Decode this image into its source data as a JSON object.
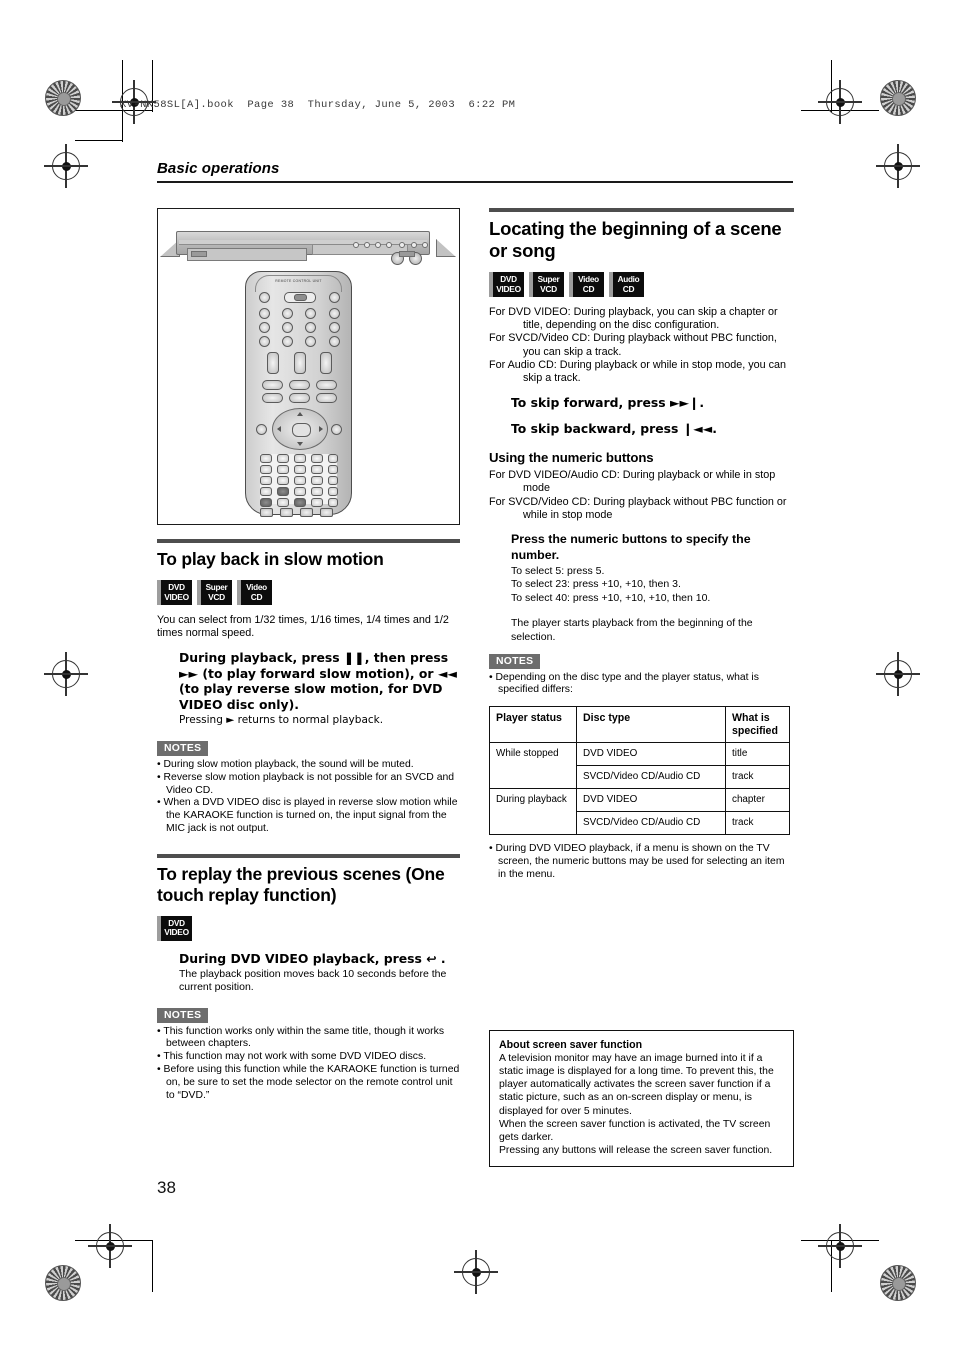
{
  "running_head": "XV-NK58SL[A].book  Page 38  Thursday, June 5, 2003  6:22 PM",
  "section_label": "Basic operations",
  "page_number": "38",
  "figure": {
    "caption": "",
    "remote_brand": "REMOTE CONTROL UNIT"
  },
  "left_column": {
    "section1": {
      "heading": "To play back in slow motion",
      "badges": [
        {
          "line1": "DVD",
          "line2": "VIDEO"
        },
        {
          "line1": "Super",
          "line2": "VCD"
        },
        {
          "line1": "Video",
          "line2": "CD"
        }
      ],
      "intro": "You can select from 1/32 times, 1/16 times, 1/4 times and 1/2 times normal speed.",
      "instruction": "During playback, press ❚❚, then press ►► (to play forward slow motion), or ◄◄ (to play reverse slow motion, for DVD VIDEO disc only).",
      "instruction_note": "Pressing ► returns to normal playback.",
      "notes_label": "NOTES",
      "notes": [
        "During slow motion playback, the sound will be muted.",
        "Reverse slow motion playback is not possible for an SVCD and Video CD.",
        "When a DVD VIDEO disc is played in reverse slow motion while the KARAOKE function is turned on, the input signal from the MIC jack is not output."
      ]
    },
    "section2": {
      "heading": "To replay the previous scenes (One touch replay function)",
      "badges": [
        {
          "line1": "DVD",
          "line2": "VIDEO"
        }
      ],
      "instruction": "During DVD VIDEO playback, press ↩ .",
      "instruction_note": "The playback position moves back 10 seconds before the current position.",
      "notes_label": "NOTES",
      "notes": [
        "This function works only within the same title, though it works between chapters.",
        "This function may not work with some DVD VIDEO discs.",
        "Before using this function while the KARAOKE function is turned on, be sure to set the mode selector on the remote control unit to “DVD.”"
      ]
    }
  },
  "right_column": {
    "heading": "Locating the beginning of a scene or song",
    "badges": [
      {
        "line1": "DVD",
        "line2": "VIDEO"
      },
      {
        "line1": "Super",
        "line2": "VCD"
      },
      {
        "line1": "Video",
        "line2": "CD"
      },
      {
        "line1": "Audio",
        "line2": "CD"
      }
    ],
    "intro_lines": [
      "For DVD VIDEO: During playback, you can skip a chapter or title, depending on the disc configuration.",
      "For SVCD/Video CD: During playback without PBC function, you can skip a track.",
      "For Audio CD: During playback or while in stop mode, you can skip a track."
    ],
    "skip_forward": "To skip forward, press ►►❙.",
    "skip_backward": "To skip backward, press ❙◄◄.",
    "numeric": {
      "heading": "Using the numeric buttons",
      "lines": [
        "For DVD VIDEO/Audio CD: During playback or while in stop mode",
        "For SVCD/Video CD: During playback without PBC function or while in stop mode"
      ],
      "instruction": "Press the numeric buttons to specify the number.",
      "examples": [
        "To select 5: press 5.",
        "To select 23: press +10, +10, then 3.",
        "To select 40: press +10, +10, +10, then 10."
      ],
      "result": "The player starts playback from the beginning of the selection."
    },
    "notes_label": "NOTES",
    "note_table_intro": "Depending on the disc type and the player status, what is specified differs:",
    "table": {
      "headers": [
        "Player status",
        "Disc type",
        "What is specified"
      ],
      "rows": [
        {
          "status": "While stopped",
          "disc": "DVD VIDEO",
          "specified": "title"
        },
        {
          "status": "",
          "disc": "SVCD/Video CD/Audio CD",
          "specified": "track"
        },
        {
          "status": "During playback",
          "disc": "DVD VIDEO",
          "specified": "chapter"
        },
        {
          "status": "",
          "disc": "SVCD/Video CD/Audio CD",
          "specified": "track"
        }
      ]
    },
    "note_after_table": "During DVD VIDEO playback, if a menu is shown on the TV screen, the numeric buttons may be used for selecting an item in the menu.",
    "screensaver": {
      "title": "About screen saver function",
      "body": "A television monitor may have an image burned into it if a static image is displayed for a long time. To prevent this, the player automatically activates the screen saver function if a static picture, such as an on-screen display or menu, is displayed for over 5 minutes.\nWhen the screen saver function is activated, the TV screen gets darker.\nPressing any buttons will release the screen saver function."
    }
  }
}
